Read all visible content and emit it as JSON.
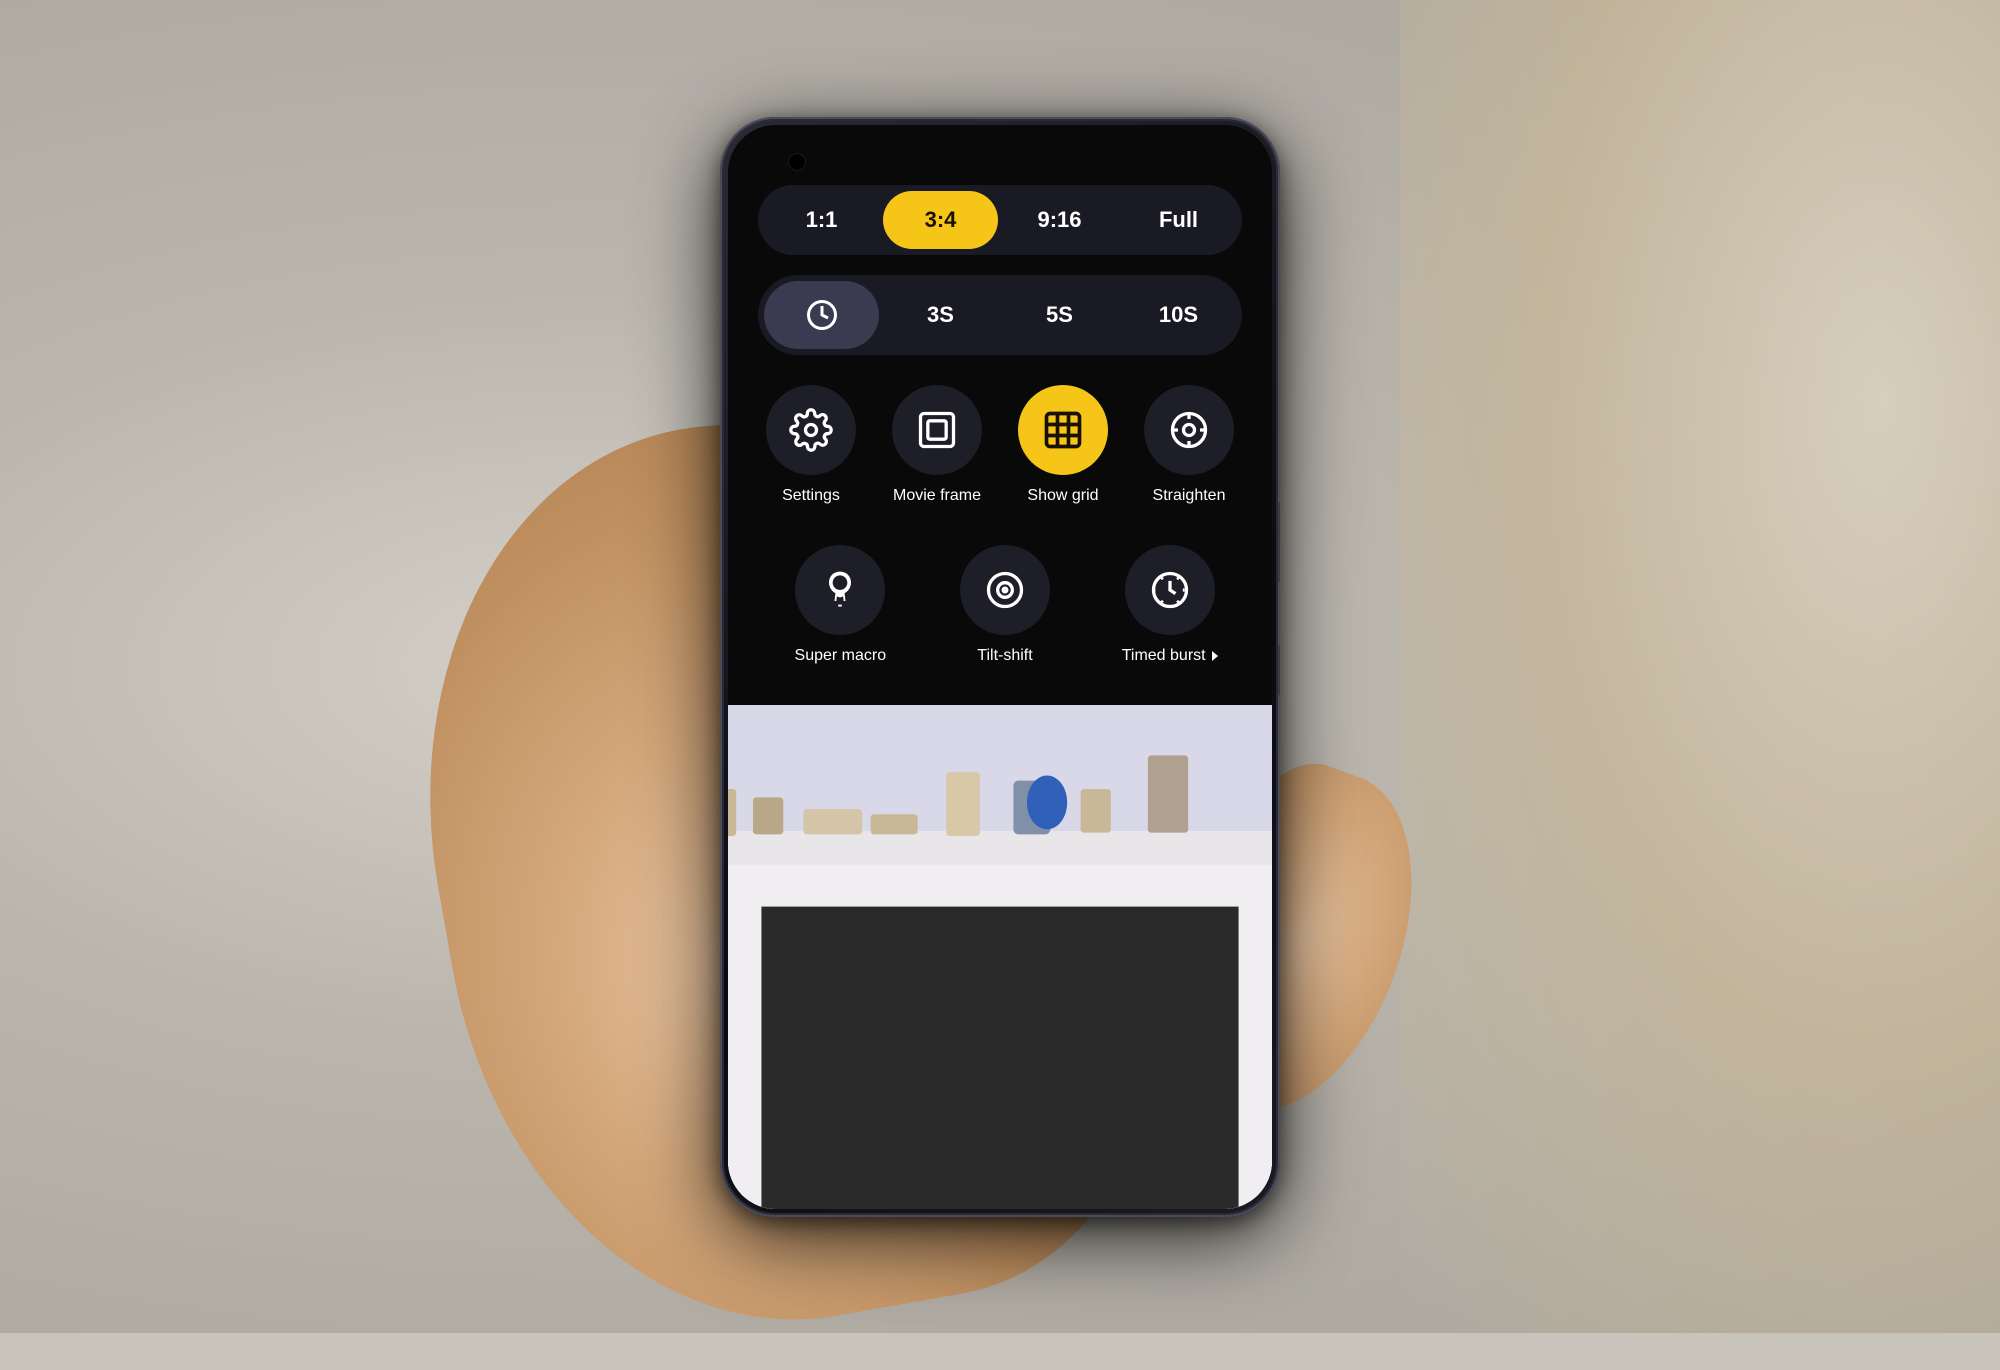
{
  "background": {
    "color": "#c0bbb4"
  },
  "phone": {
    "aspect_ratios": [
      {
        "label": "1:1",
        "active": false
      },
      {
        "label": "3:4",
        "active": true
      },
      {
        "label": "9:16",
        "active": false
      },
      {
        "label": "Full",
        "active": false
      }
    ],
    "timer_options": [
      {
        "label": "⏱",
        "type": "icon",
        "active": true
      },
      {
        "label": "3S",
        "active": false
      },
      {
        "label": "5S",
        "active": false
      },
      {
        "label": "10S",
        "active": false
      }
    ],
    "icons_row1": [
      {
        "id": "settings",
        "label": "Settings",
        "active": false
      },
      {
        "id": "movie-frame",
        "label": "Movie frame",
        "active": false
      },
      {
        "id": "show-grid",
        "label": "Show grid",
        "active": true
      },
      {
        "id": "straighten",
        "label": "Straighten",
        "active": false
      }
    ],
    "icons_row2": [
      {
        "id": "super-macro",
        "label": "Super macro",
        "active": false
      },
      {
        "id": "tilt-shift",
        "label": "Tilt-shift",
        "active": false
      },
      {
        "id": "timed-burst",
        "label": "Timed burst",
        "active": false,
        "has_arrow": true
      }
    ]
  }
}
